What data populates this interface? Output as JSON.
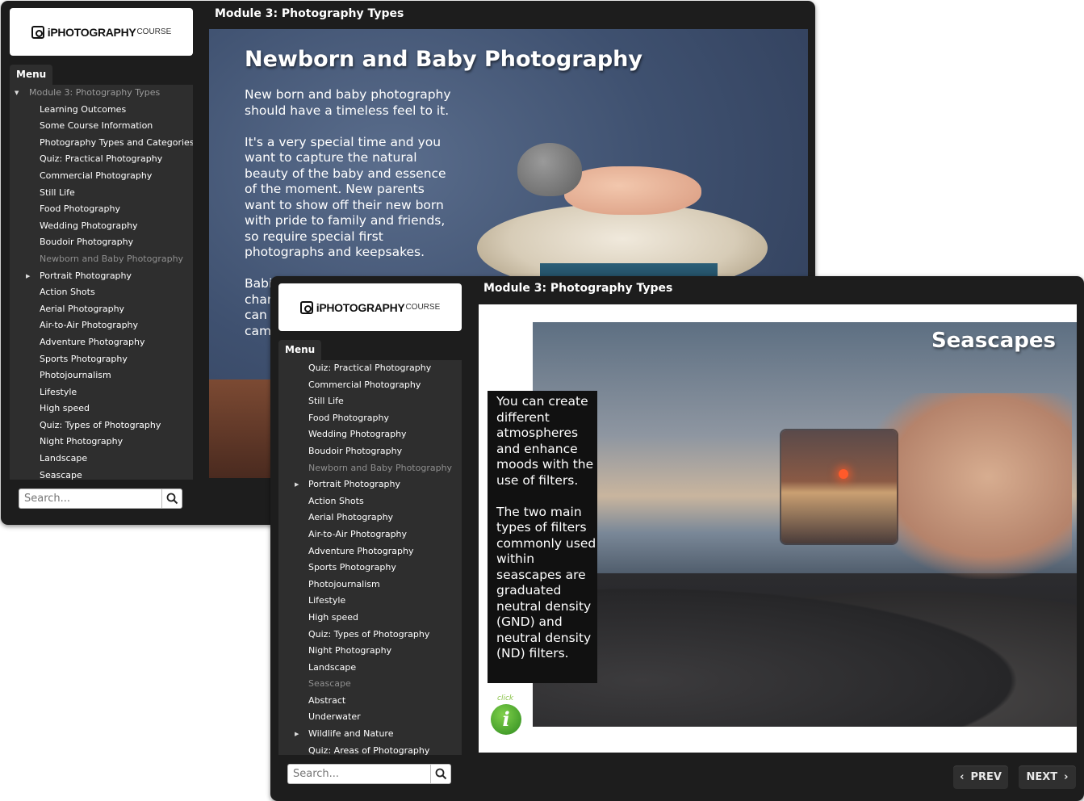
{
  "back_window": {
    "logo": {
      "brand": "iPHOTOGRAPHY",
      "suffix": "COURSE"
    },
    "module_title": "Module 3: Photography Types",
    "menu_label": "Menu",
    "module_item": "Module 3: Photography Types",
    "menu_items": [
      "Learning Outcomes",
      "Some Course Information",
      "Photography Types and Categories",
      "Quiz: Practical Photography",
      "Commercial Photography",
      "Still Life",
      "Food Photography",
      "Wedding Photography",
      "Boudoir Photography",
      "Newborn and Baby Photography",
      "Portrait Photography",
      "Action Shots",
      "Aerial Photography",
      "Air-to-Air Photography",
      "Adventure Photography",
      "Sports Photography",
      "Photojournalism",
      "Lifestyle",
      "High speed",
      "Quiz: Types of Photography",
      "Night Photography",
      "Landscape",
      "Seascape"
    ],
    "current_item": "Newborn and Baby Photography",
    "search_placeholder": "Search...",
    "slide": {
      "heading": "Newborn and Baby Photography",
      "paragraph1": "New born and baby photography should have a timeless feel to it.",
      "paragraph2": "It's a very special time and you want to capture the natural beauty of the baby and essence of the moment. New parents want to show off their new born with pride to family and friends, so require special first photographs and keepsakes.",
      "paragraph3": "Babi\nchar\ncan\ncam"
    }
  },
  "front_window": {
    "logo": {
      "brand": "iPHOTOGRAPHY",
      "suffix": "COURSE"
    },
    "module_title": "Module 3: Photography Types",
    "menu_label": "Menu",
    "menu_items": [
      "Quiz: Practical Photography",
      "Commercial Photography",
      "Still Life",
      "Food Photography",
      "Wedding Photography",
      "Boudoir Photography",
      "Newborn and Baby Photography",
      "Portrait Photography",
      "Action Shots",
      "Aerial Photography",
      "Air-to-Air Photography",
      "Adventure Photography",
      "Sports Photography",
      "Photojournalism",
      "Lifestyle",
      "High speed",
      "Quiz: Types of Photography",
      "Night Photography",
      "Landscape",
      "Seascape",
      "Abstract",
      "Underwater",
      "Wildlife and Nature",
      "Quiz: Areas of Photography"
    ],
    "search_placeholder": "Search...",
    "slide": {
      "title": "Seascapes",
      "paragraph1": "You can create different atmospheres and enhance moods with the use of filters.",
      "paragraph2": "The two main types of filters commonly used within seascapes are graduated neutral density (GND) and neutral density (ND) filters.",
      "click_label": "click",
      "info_glyph": "i"
    },
    "prev_label": "PREV",
    "next_label": "NEXT"
  }
}
